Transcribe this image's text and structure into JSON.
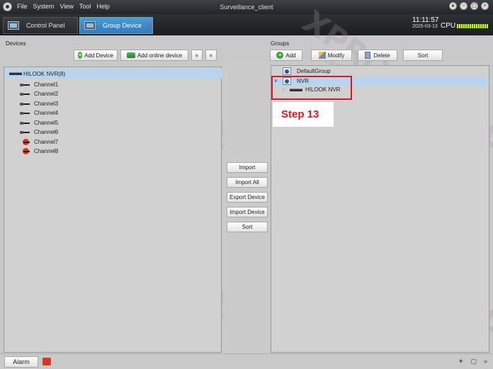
{
  "window": {
    "title": "Surveillance_client",
    "menu": [
      "File",
      "System",
      "View",
      "Tool",
      "Help"
    ],
    "controls": [
      "●",
      "−",
      "▢",
      "×"
    ]
  },
  "tabs": [
    {
      "label": "Control Panel",
      "active": false
    },
    {
      "label": "Group Device",
      "active": true,
      "close": "×"
    }
  ],
  "status": {
    "time": "11:11:57",
    "date": "2025-03-13",
    "cpu_label": "CPU"
  },
  "devices": {
    "title": "Devices",
    "toolbar": {
      "add_device": "Add Device",
      "add_online": "Add online device",
      "expand": "»",
      "collapse": "«"
    },
    "nvr": {
      "label": "HILOOK NVR(8)"
    },
    "channels": [
      {
        "label": "Channel1",
        "online": true
      },
      {
        "label": "Channel2",
        "online": true
      },
      {
        "label": "Channel3",
        "online": true
      },
      {
        "label": "Channel4",
        "online": true
      },
      {
        "label": "Channel5",
        "online": true
      },
      {
        "label": "Channel6",
        "online": true
      },
      {
        "label": "Channel7",
        "online": false
      },
      {
        "label": "Channel8",
        "online": false
      }
    ]
  },
  "middle": {
    "import": "Import",
    "import_all": "Import All",
    "export_device": "Export Device",
    "import_device": "Import Device",
    "sort": "Sort"
  },
  "groups": {
    "title": "Groups",
    "toolbar": {
      "add": "Add",
      "modify": "Modify",
      "delete": "Delete",
      "sort": "Sort"
    },
    "items": [
      {
        "label": "DefaultGroup"
      },
      {
        "label": "NVR",
        "expanded": true,
        "expander": "˅"
      },
      {
        "label": "HILOOK NVR",
        "expander": "›"
      }
    ]
  },
  "annotation": {
    "step": "Step 13",
    "color": "#e0141f"
  },
  "statusbar": {
    "alarm": "Alarm",
    "icons": [
      "✶",
      "▢",
      "»"
    ]
  },
  "watermark": {
    "brand": "XPRO",
    "sub": "SECURITY"
  }
}
